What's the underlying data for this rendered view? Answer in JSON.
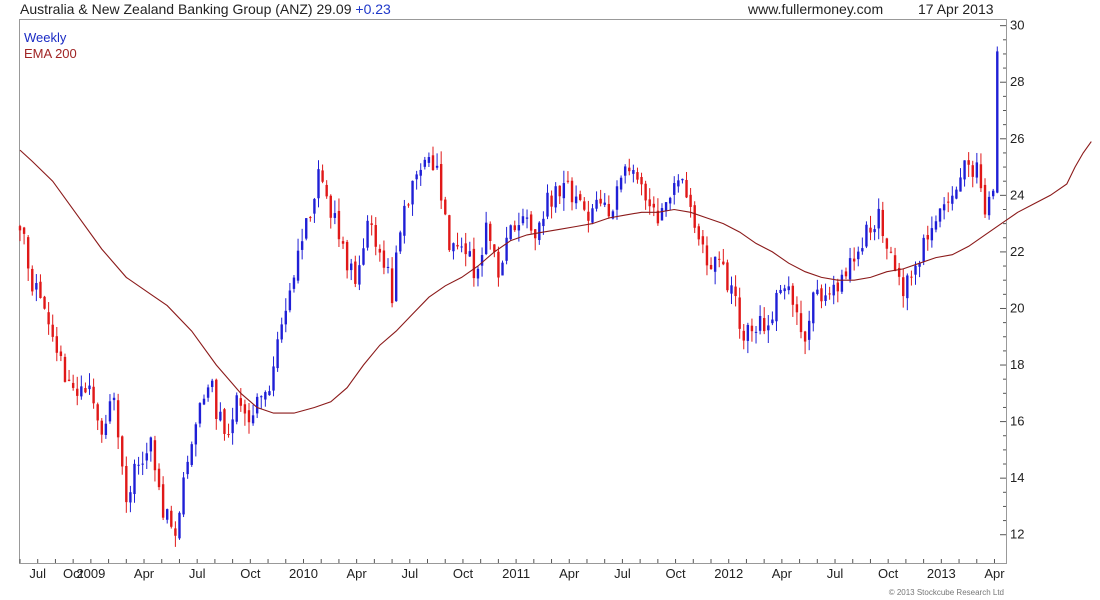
{
  "header": {
    "title": "Australia & New Zealand Banking Group (ANZ)",
    "price": "29.09",
    "change": "+0.23",
    "site": "www.fullermoney.com",
    "date": "17 Apr 2013"
  },
  "legend": {
    "weekly": "Weekly",
    "ema": "EMA 200"
  },
  "copyright": "© 2013 Stockcube Research Ltd",
  "colors": {
    "up": "#1f1fd6",
    "down": "#e01818",
    "ema": "#8b1a1a",
    "axis": "#555555",
    "frame": "#999999"
  },
  "chart_data": {
    "type": "candlestick",
    "title": "Australia & New Zealand Banking Group (ANZ) 29.09 +0.23",
    "period": "Weekly",
    "ylim": [
      11,
      30.2
    ],
    "y_ticks": [
      12,
      14,
      16,
      18,
      20,
      22,
      24,
      26,
      28,
      30
    ],
    "y_axis_side": "right",
    "x_tick_labels": [
      "Jul",
      "Oct",
      "2009",
      "Apr",
      "Jul",
      "Oct",
      "2010",
      "Apr",
      "Jul",
      "Oct",
      "2011",
      "Apr",
      "Jul",
      "Oct",
      "2012",
      "Apr",
      "Jul",
      "Oct",
      "2013",
      "Apr"
    ],
    "x_label_units": [
      1,
      3,
      4,
      7,
      10,
      13,
      16,
      19,
      22,
      25,
      28,
      31,
      34,
      37,
      40,
      43,
      46,
      49,
      52,
      55
    ],
    "x_range_units": [
      0,
      55.65
    ],
    "weeks": 240,
    "weeks_per_unit": 4.333,
    "grid": false,
    "legend_position": "top-left",
    "close_anchors": [
      [
        0,
        23.0
      ],
      [
        3,
        21.0
      ],
      [
        6,
        19.8
      ],
      [
        10,
        18.2
      ],
      [
        14,
        16.8
      ],
      [
        17,
        17.5
      ],
      [
        20,
        15.9
      ],
      [
        23,
        16.7
      ],
      [
        26,
        13.2
      ],
      [
        29,
        14.5
      ],
      [
        32,
        15.0
      ],
      [
        35,
        12.8
      ],
      [
        38,
        12.4
      ],
      [
        41,
        14.8
      ],
      [
        44,
        17.0
      ],
      [
        47,
        17.1
      ],
      [
        50,
        15.3
      ],
      [
        53,
        17.1
      ],
      [
        56,
        16.3
      ],
      [
        60,
        16.8
      ],
      [
        64,
        19.5
      ],
      [
        67,
        21.5
      ],
      [
        70,
        23.0
      ],
      [
        73,
        24.8
      ],
      [
        76,
        23.5
      ],
      [
        79,
        22.0
      ],
      [
        82,
        21.2
      ],
      [
        85,
        22.7
      ],
      [
        88,
        22.4
      ],
      [
        91,
        20.6
      ],
      [
        93,
        22.8
      ],
      [
        96,
        24.5
      ],
      [
        99,
        25.4
      ],
      [
        102,
        24.8
      ],
      [
        105,
        22.1
      ],
      [
        108,
        22.5
      ],
      [
        111,
        21.3
      ],
      [
        114,
        22.6
      ],
      [
        117,
        21.1
      ],
      [
        120,
        22.8
      ],
      [
        123,
        23.3
      ],
      [
        126,
        22.9
      ],
      [
        129,
        23.8
      ],
      [
        132,
        24.4
      ],
      [
        135,
        24.1
      ],
      [
        138,
        23.3
      ],
      [
        141,
        23.9
      ],
      [
        144,
        23.5
      ],
      [
        147,
        24.3
      ],
      [
        150,
        25.2
      ],
      [
        153,
        23.4
      ],
      [
        156,
        23.3
      ],
      [
        159,
        24.0
      ],
      [
        162,
        24.6
      ],
      [
        165,
        23.0
      ],
      [
        168,
        21.7
      ],
      [
        171,
        21.4
      ],
      [
        174,
        20.9
      ],
      [
        177,
        19.0
      ],
      [
        180,
        19.6
      ],
      [
        183,
        19.1
      ],
      [
        186,
        21.0
      ],
      [
        189,
        20.4
      ],
      [
        192,
        19.2
      ],
      [
        195,
        20.8
      ],
      [
        198,
        20.5
      ],
      [
        201,
        21.2
      ],
      [
        204,
        21.8
      ],
      [
        207,
        22.6
      ],
      [
        210,
        23.4
      ],
      [
        213,
        22.0
      ],
      [
        216,
        20.6
      ],
      [
        219,
        21.8
      ],
      [
        222,
        22.4
      ],
      [
        225,
        23.2
      ],
      [
        228,
        24.3
      ],
      [
        231,
        24.9
      ],
      [
        234,
        25.1
      ],
      [
        236,
        23.6
      ],
      [
        238,
        24.5
      ],
      [
        241,
        25.0
      ],
      [
        244,
        25.6
      ],
      [
        247,
        26.6
      ],
      [
        250,
        28.0
      ],
      [
        253,
        28.6
      ],
      [
        256,
        28.6
      ],
      [
        258,
        28.1
      ],
      [
        260,
        29.09
      ]
    ],
    "series": [
      {
        "name": "Weekly",
        "kind": "candlestick",
        "up_color": "#1f1fd6",
        "down_color": "#e01818"
      },
      {
        "name": "EMA 200",
        "kind": "line",
        "color": "#8b1a1a",
        "points": [
          [
            0,
            25.6
          ],
          [
            3,
            25.2
          ],
          [
            8,
            24.5
          ],
          [
            14,
            23.3
          ],
          [
            20,
            22.1
          ],
          [
            26,
            21.1
          ],
          [
            32,
            20.5
          ],
          [
            36,
            20.1
          ],
          [
            42,
            19.2
          ],
          [
            48,
            18.0
          ],
          [
            54,
            17.0
          ],
          [
            58,
            16.5
          ],
          [
            62,
            16.3
          ],
          [
            67,
            16.3
          ],
          [
            72,
            16.5
          ],
          [
            76,
            16.7
          ],
          [
            80,
            17.2
          ],
          [
            84,
            18.0
          ],
          [
            88,
            18.7
          ],
          [
            92,
            19.2
          ],
          [
            96,
            19.8
          ],
          [
            100,
            20.4
          ],
          [
            104,
            20.8
          ],
          [
            108,
            21.1
          ],
          [
            112,
            21.5
          ],
          [
            116,
            22.0
          ],
          [
            120,
            22.4
          ],
          [
            124,
            22.6
          ],
          [
            128,
            22.7
          ],
          [
            132,
            22.8
          ],
          [
            136,
            22.9
          ],
          [
            140,
            23.0
          ],
          [
            144,
            23.2
          ],
          [
            148,
            23.3
          ],
          [
            152,
            23.4
          ],
          [
            156,
            23.4
          ],
          [
            160,
            23.5
          ],
          [
            164,
            23.4
          ],
          [
            168,
            23.2
          ],
          [
            172,
            23.0
          ],
          [
            176,
            22.7
          ],
          [
            180,
            22.3
          ],
          [
            184,
            22.0
          ],
          [
            188,
            21.6
          ],
          [
            192,
            21.3
          ],
          [
            196,
            21.1
          ],
          [
            200,
            21.0
          ],
          [
            204,
            21.0
          ],
          [
            208,
            21.1
          ],
          [
            212,
            21.3
          ],
          [
            216,
            21.4
          ],
          [
            220,
            21.6
          ],
          [
            224,
            21.8
          ],
          [
            228,
            21.9
          ],
          [
            232,
            22.2
          ],
          [
            236,
            22.6
          ],
          [
            240,
            23.0
          ],
          [
            244,
            23.4
          ],
          [
            248,
            23.7
          ],
          [
            252,
            24.0
          ],
          [
            256,
            24.4
          ],
          [
            258,
            25.0
          ],
          [
            260,
            25.5
          ],
          [
            262,
            25.9
          ]
        ]
      }
    ]
  }
}
